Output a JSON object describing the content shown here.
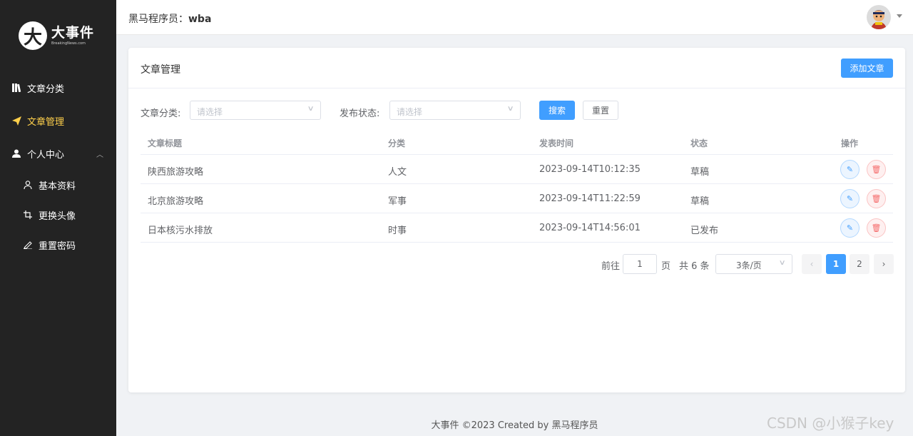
{
  "sidebar": {
    "logo_title": "大事件",
    "logo_sub": "BreakingNews.com",
    "items": [
      {
        "label": "文章分类",
        "icon": "book-icon"
      },
      {
        "label": "文章管理",
        "icon": "send-icon"
      },
      {
        "label": "个人中心",
        "icon": "user-icon"
      }
    ],
    "sub_items": [
      {
        "label": "基本资料",
        "icon": "user-outline-icon"
      },
      {
        "label": "更换头像",
        "icon": "crop-icon"
      },
      {
        "label": "重置密码",
        "icon": "edit-pen-icon"
      }
    ]
  },
  "header": {
    "user_prefix": "黑马程序员：",
    "user_name": "wba"
  },
  "card": {
    "title": "文章管理",
    "add_label": "添加文章"
  },
  "filter": {
    "category_label": "文章分类:",
    "category_placeholder": "请选择",
    "state_label": "发布状态:",
    "state_placeholder": "请选择",
    "search_label": "搜索",
    "reset_label": "重置"
  },
  "table": {
    "headers": [
      "文章标题",
      "分类",
      "发表时间",
      "状态",
      "操作"
    ],
    "rows": [
      {
        "title": "陕西旅游攻略",
        "category": "人文",
        "time": "2023-09-14T10:12:35",
        "state": "草稿"
      },
      {
        "title": "北京旅游攻略",
        "category": "军事",
        "time": "2023-09-14T11:22:59",
        "state": "草稿"
      },
      {
        "title": "日本核污水排放",
        "category": "时事",
        "time": "2023-09-14T14:56:01",
        "state": "已发布"
      }
    ]
  },
  "pager": {
    "goto_label": "前往",
    "page_value": "1",
    "page_unit": "页",
    "total": "共 6 条",
    "size_label": "3条/页",
    "pages": [
      "1",
      "2"
    ],
    "current": "1",
    "prev": "‹",
    "next": "›"
  },
  "footer": "大事件 ©2023 Created by 黑马程序员",
  "watermark": "CSDN @小猴子key",
  "colors": {
    "primary": "#409eff",
    "sidebar_bg": "#232323",
    "active": "#ffd04b",
    "danger": "#f56c6c"
  }
}
